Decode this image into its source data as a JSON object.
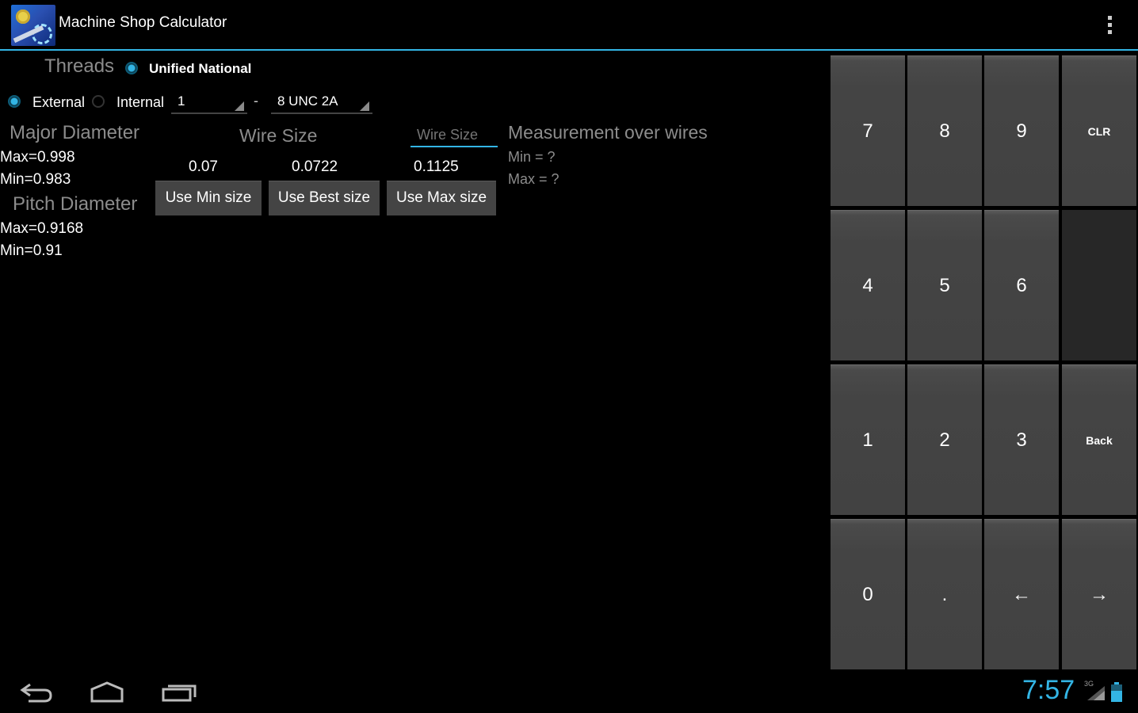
{
  "app": {
    "title": "Machine Shop Calculator"
  },
  "threads": {
    "label": "Threads",
    "standard_option": "Unified National"
  },
  "type_options": {
    "external": "External",
    "internal": "Internal"
  },
  "size_spinner": {
    "value": "1"
  },
  "dash": "-",
  "pitch_spinner": {
    "value": "8 UNC 2A"
  },
  "major_diameter": {
    "label": "Major Diameter",
    "max": "Max=0.998",
    "min": "Min=0.983"
  },
  "pitch_diameter": {
    "label": "Pitch Diameter",
    "max": "Max=0.9168",
    "min": "Min=0.91"
  },
  "wire_size": {
    "label": "Wire Size",
    "input_placeholder": "Wire Size",
    "min_value": "0.07",
    "best_value": "0.0722",
    "max_value": "0.1125",
    "use_min_button": "Use Min size",
    "use_best_button": "Use Best size",
    "use_max_button": "Use Max size"
  },
  "measurement": {
    "label": "Measurement over wires",
    "min": "Min = ?",
    "max": "Max = ?"
  },
  "keypad": {
    "k7": "7",
    "k8": "8",
    "k9": "9",
    "clr": "CLR",
    "k4": "4",
    "k5": "5",
    "k6": "6",
    "k1": "1",
    "k2": "2",
    "k3": "3",
    "back": "Back",
    "k0": "0",
    "dot": ".",
    "left": "←",
    "right": "→"
  },
  "status": {
    "time": "7:57",
    "network": "3G"
  },
  "colors": {
    "accent": "#33b5e5",
    "key_bg": "#444444",
    "background": "#000000"
  },
  "icons": [
    "back-icon",
    "home-icon",
    "recent-apps-icon",
    "overflow-menu-icon",
    "signal-icon",
    "battery-icon"
  ]
}
